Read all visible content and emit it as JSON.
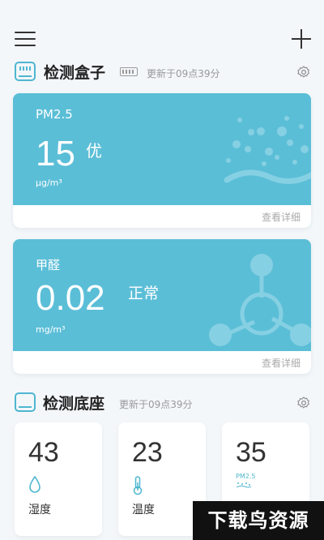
{
  "header": {
    "menu_icon": "menu-icon",
    "add_icon": "plus-icon"
  },
  "box_section": {
    "title": "检测盒子",
    "updated": "更新于09点39分"
  },
  "pm_card": {
    "label": "PM2.5",
    "value": "15",
    "grade": "优",
    "unit": "μg/m³",
    "detail_link": "查看详细"
  },
  "formaldehyde_card": {
    "label": "甲醛",
    "value": "0.02",
    "grade": "正常",
    "unit": "mg/m³",
    "detail_link": "查看详细"
  },
  "base_section": {
    "title": "检测底座",
    "updated": "更新于09点39分"
  },
  "tiles": [
    {
      "value": "43",
      "label": "湿度",
      "icon": "water-drop-icon"
    },
    {
      "value": "23",
      "label": "温度",
      "icon": "thermometer-icon"
    },
    {
      "value": "35",
      "label": "PM2.5",
      "icon": "pm-icon"
    }
  ],
  "watermark": "下载鸟资源",
  "colors": {
    "accent": "#5bbed7",
    "icon": "#4fb6d0"
  }
}
